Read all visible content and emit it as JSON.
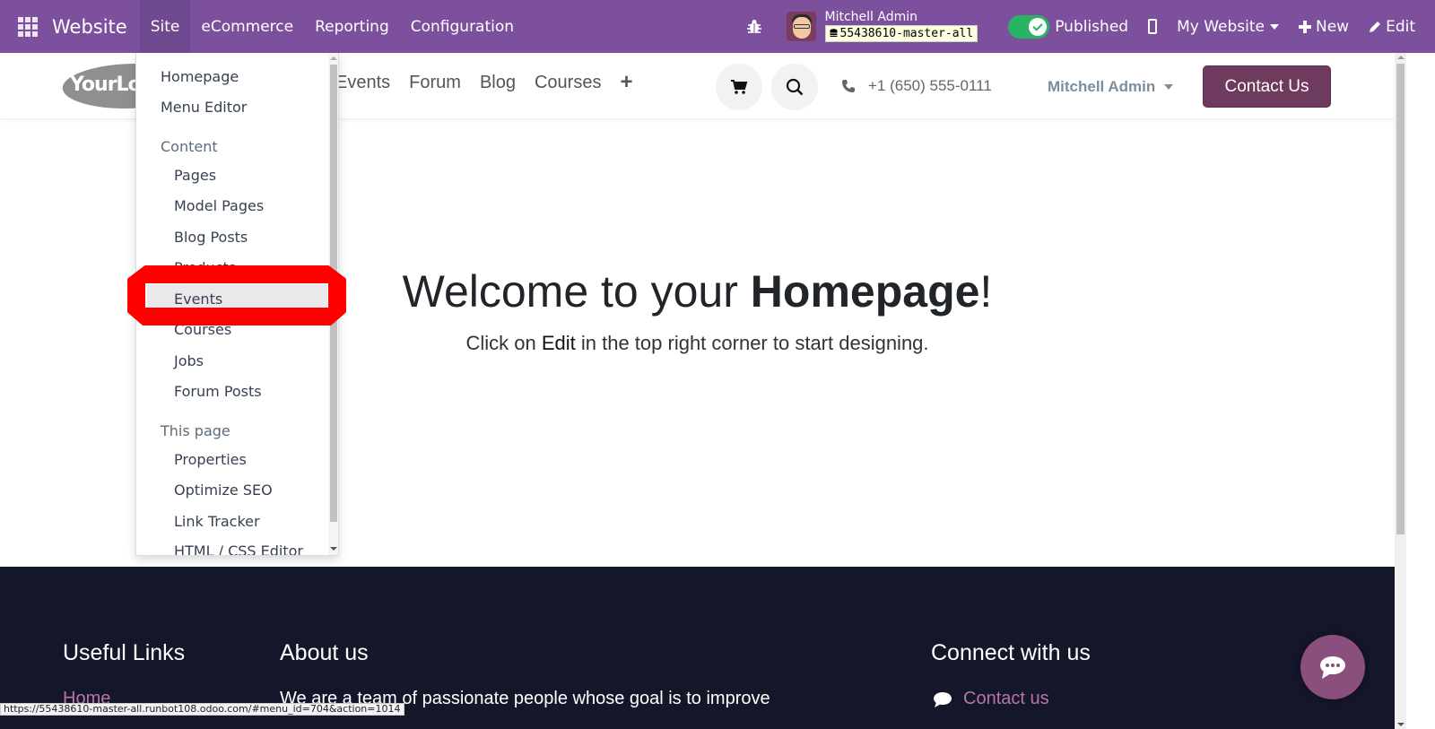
{
  "topbar": {
    "app_name": "Website",
    "menu": [
      {
        "label": "Site",
        "active": true
      },
      {
        "label": "eCommerce",
        "active": false
      },
      {
        "label": "Reporting",
        "active": false
      },
      {
        "label": "Configuration",
        "active": false
      }
    ],
    "user_name": "Mitchell Admin",
    "database": "55438610-master-all",
    "publish_toggle": {
      "label": "Published",
      "checked": true
    },
    "website_switcher": "My Website",
    "new_label": "New",
    "edit_label": "Edit",
    "colors": {
      "bar": "#7c509c",
      "toggle_on": "#28b463"
    }
  },
  "site_header": {
    "logo_text": "YourLo",
    "nav": [
      "Events",
      "Forum",
      "Blog",
      "Courses"
    ],
    "nav_add_icon": "plus-icon",
    "phone": "+1 (650) 555-0111",
    "user": "Mitchell Admin",
    "contact_button": "Contact Us",
    "colors": {
      "contact_button": "#6e3a5e"
    }
  },
  "dropdown": {
    "top_items": [
      "Homepage",
      "Menu Editor"
    ],
    "sections": [
      {
        "header": "Content",
        "items": [
          "Pages",
          "Model Pages",
          "Blog Posts",
          "Products",
          "Events",
          "Courses",
          "Jobs",
          "Forum Posts"
        ]
      },
      {
        "header": "This page",
        "items": [
          "Properties",
          "Optimize SEO",
          "Link Tracker",
          "HTML / CSS Editor"
        ]
      }
    ],
    "highlighted_item": "Events"
  },
  "hero": {
    "title_prefix": "Welcome to your ",
    "title_bold": "Homepage",
    "title_suffix": "!",
    "subtitle_prefix": "Click on ",
    "subtitle_bold": "Edit",
    "subtitle_suffix": " in the top right corner to start designing."
  },
  "footer": {
    "columns": [
      {
        "heading": "Useful Links",
        "first_link": "Home"
      },
      {
        "heading": "About us",
        "text": "We are a team of passionate people whose goal is to improve"
      },
      {
        "heading": "Connect with us",
        "first_link": "Contact us"
      }
    ],
    "colors": {
      "background": "#141629",
      "link": "#b576a6",
      "chat_button": "#8a4f7d"
    }
  },
  "status_bar_url": "https://55438610-master-all.runbot108.odoo.com/#menu_id=704&action=1014"
}
